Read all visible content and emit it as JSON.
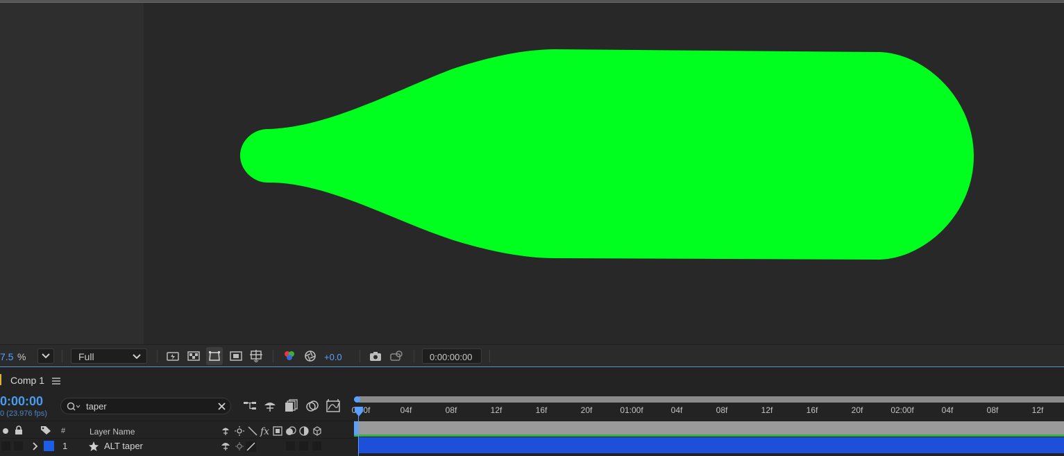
{
  "viewer": {
    "zoom_value": "7.5",
    "zoom_unit": "%",
    "resolution": "Full",
    "exposure": "+0.0",
    "timecode": "0:00:00:00",
    "shape_color": "#00ff1e"
  },
  "panel": {
    "tab_label": "Comp 1",
    "menu_icon": "hamburger-icon"
  },
  "timeline": {
    "current_time": "0:00:00",
    "fps_text": "0 (23.976 fps)",
    "search_value": "taper",
    "columns": {
      "number": "#",
      "layer_name": "Layer Name"
    },
    "layers": [
      {
        "index": "1",
        "name": "ALT taper",
        "label_color": "#1e5ee6",
        "type_icon": "star-icon"
      }
    ],
    "ruler_ticks": [
      "0:00f",
      "04f",
      "08f",
      "12f",
      "16f",
      "20f",
      "01:00f",
      "04f",
      "08f",
      "12f",
      "16f",
      "20f",
      "02:00f",
      "04f",
      "08f",
      "12f"
    ],
    "layer_bar_color": "#1d4fd8",
    "work_area_color": "#9a9a9a"
  }
}
